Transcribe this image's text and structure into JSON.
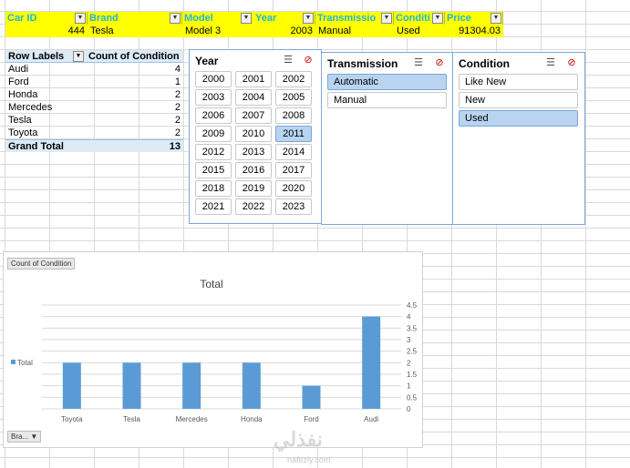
{
  "table": {
    "headers": [
      "Car ID",
      "Brand",
      "Model",
      "Year",
      "Transmissio",
      "Conditi",
      "Price"
    ],
    "row": [
      "444",
      "Tesla",
      "Model 3",
      "2003",
      "Manual",
      "Used",
      "91304.03"
    ]
  },
  "pivot": {
    "row_labels": "Row Labels",
    "count_label": "Count of Condition",
    "rows": [
      {
        "label": "Audi",
        "value": "4"
      },
      {
        "label": "Ford",
        "value": "1"
      },
      {
        "label": "Honda",
        "value": "2"
      },
      {
        "label": "Mercedes",
        "value": "2"
      },
      {
        "label": "Tesla",
        "value": "2"
      },
      {
        "label": "Toyota",
        "value": "2"
      }
    ],
    "grand_total_label": "Grand Total",
    "grand_total_value": "13"
  },
  "slicers": {
    "year": {
      "title": "Year",
      "items": [
        "2000",
        "2001",
        "2002",
        "2003",
        "2004",
        "2005",
        "2006",
        "2007",
        "2008",
        "2009",
        "2010",
        "2011",
        "2012",
        "2013",
        "2014",
        "2015",
        "2016",
        "2017",
        "2018",
        "2019",
        "2020",
        "2021",
        "2022",
        "2023"
      ],
      "selected": "2011"
    },
    "transmission": {
      "title": "Transmission",
      "items": [
        "Automatic",
        "Manual"
      ],
      "selected": "Automatic"
    },
    "condition": {
      "title": "Condition",
      "items": [
        "Like New",
        "New",
        "Used"
      ],
      "selected": "Used"
    }
  },
  "chart_chips": {
    "value_field": "Count of Condition",
    "axis_field": "Bra..."
  },
  "watermark": {
    "arabic": "نفذلي",
    "latin": "nafezly.com"
  },
  "chart_data": {
    "type": "bar",
    "title": "Total",
    "categories": [
      "Toyota",
      "Tesla",
      "Mercedes",
      "Honda",
      "Ford",
      "Audi"
    ],
    "series": [
      {
        "name": "Total",
        "values": [
          2,
          2,
          2,
          2,
          1,
          4
        ]
      }
    ],
    "ylim": [
      0,
      4.5
    ],
    "yticks": [
      "0",
      "0.5",
      "1",
      "1.5",
      "2",
      "2.5",
      "3",
      "3.5",
      "4",
      "4.5"
    ],
    "grid": true,
    "legend": "left",
    "color": "#5b9bd5"
  }
}
